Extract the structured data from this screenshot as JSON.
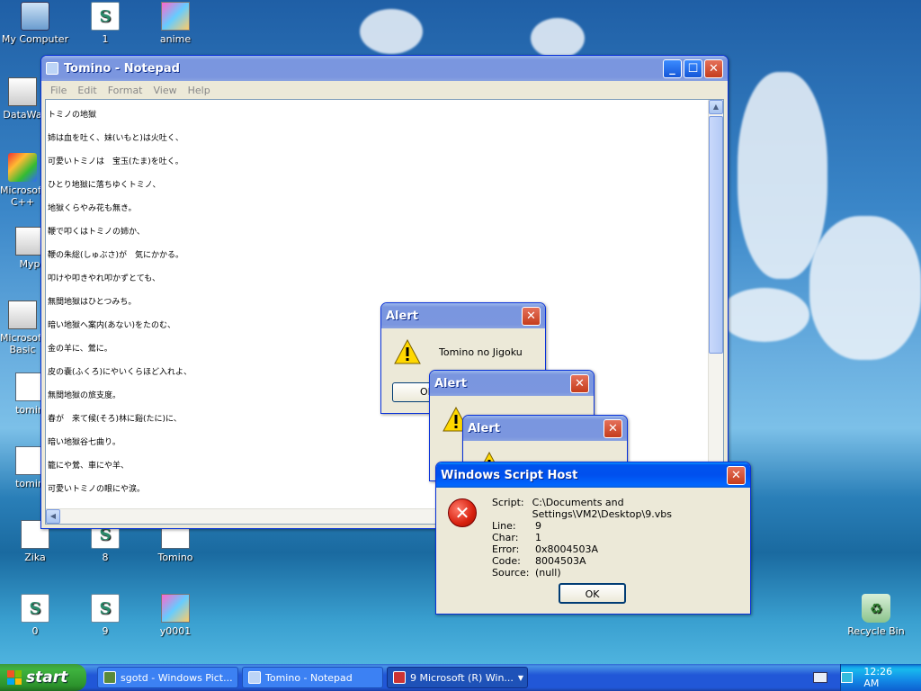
{
  "desktop": {
    "icons": [
      {
        "label": "My Computer",
        "icon": "computer-icon"
      },
      {
        "label": "1",
        "icon": "script-icon"
      },
      {
        "label": "anime",
        "icon": "image-icon"
      },
      {
        "label": "DataWa",
        "icon": "shortcut-icon"
      },
      {
        "label": "Microsoft C++",
        "icon": "cpp-icon"
      },
      {
        "label": "Myp",
        "icon": "shortcut-icon"
      },
      {
        "label": "Microsoft Basic",
        "icon": "basic-icon"
      },
      {
        "label": "tomin",
        "icon": "document-icon"
      },
      {
        "label": "tomin",
        "icon": "document-icon"
      },
      {
        "label": "Zika",
        "icon": "document-icon"
      },
      {
        "label": "8",
        "icon": "script-icon"
      },
      {
        "label": "Tomino",
        "icon": "text-file-icon"
      },
      {
        "label": "0",
        "icon": "script-icon"
      },
      {
        "label": "9",
        "icon": "script-icon"
      },
      {
        "label": "y0001",
        "icon": "image-icon"
      },
      {
        "label": "Recycle Bin",
        "icon": "recycle-bin-icon"
      }
    ]
  },
  "notepad": {
    "title": "Tomino - Notepad",
    "menu": [
      "File",
      "Edit",
      "Format",
      "View",
      "Help"
    ],
    "lines": [
      "トミノの地獄",
      "姉は血を吐く、妹(いもと)は火吐く、",
      "可愛いトミノは　宝玉(たま)を吐く。",
      "ひとり地獄に落ちゆくトミノ、",
      "地獄くらやみ花も無き。",
      "鞭で叩くはトミノの姉か、",
      "鞭の朱総(しゅぶさ)が　気にかかる。",
      "叩けや叩きやれ叩かずとても、",
      "無間地獄はひとつみち。",
      "暗い地獄へ案内(あない)をたのむ、",
      "金の羊に、鶯に。",
      "皮の嚢(ふくろ)にやいくらほど入れよ、",
      "無間地獄の旅支度。",
      "春が　来て候(そろ)林に谿(たに)に、",
      "暗い地獄谷七曲り。",
      "籠にや鶯、車にや羊、",
      "可愛いトミノの眼にや涙。"
    ]
  },
  "alert1": {
    "title": "Alert",
    "message": "Tomino no Jigoku",
    "ok": "OK"
  },
  "alert2": {
    "title": "Alert"
  },
  "alert3": {
    "title": "Alert"
  },
  "wsh": {
    "title": "Windows Script Host",
    "fields": [
      {
        "label": "Script:",
        "value": "C:\\Documents and Settings\\VM2\\Desktop\\9.vbs"
      },
      {
        "label": "Line:",
        "value": "9"
      },
      {
        "label": "Char:",
        "value": "1"
      },
      {
        "label": "Error:",
        "value": "0x8004503A"
      },
      {
        "label": "Code:",
        "value": "8004503A"
      },
      {
        "label": "Source:",
        "value": "(null)"
      }
    ],
    "ok": "OK"
  },
  "taskbar": {
    "start": "start",
    "tasks": [
      "sgotd - Windows Pict...",
      "Tomino - Notepad",
      "9 Microsoft (R) Win..."
    ],
    "clock": "12:26 AM"
  }
}
